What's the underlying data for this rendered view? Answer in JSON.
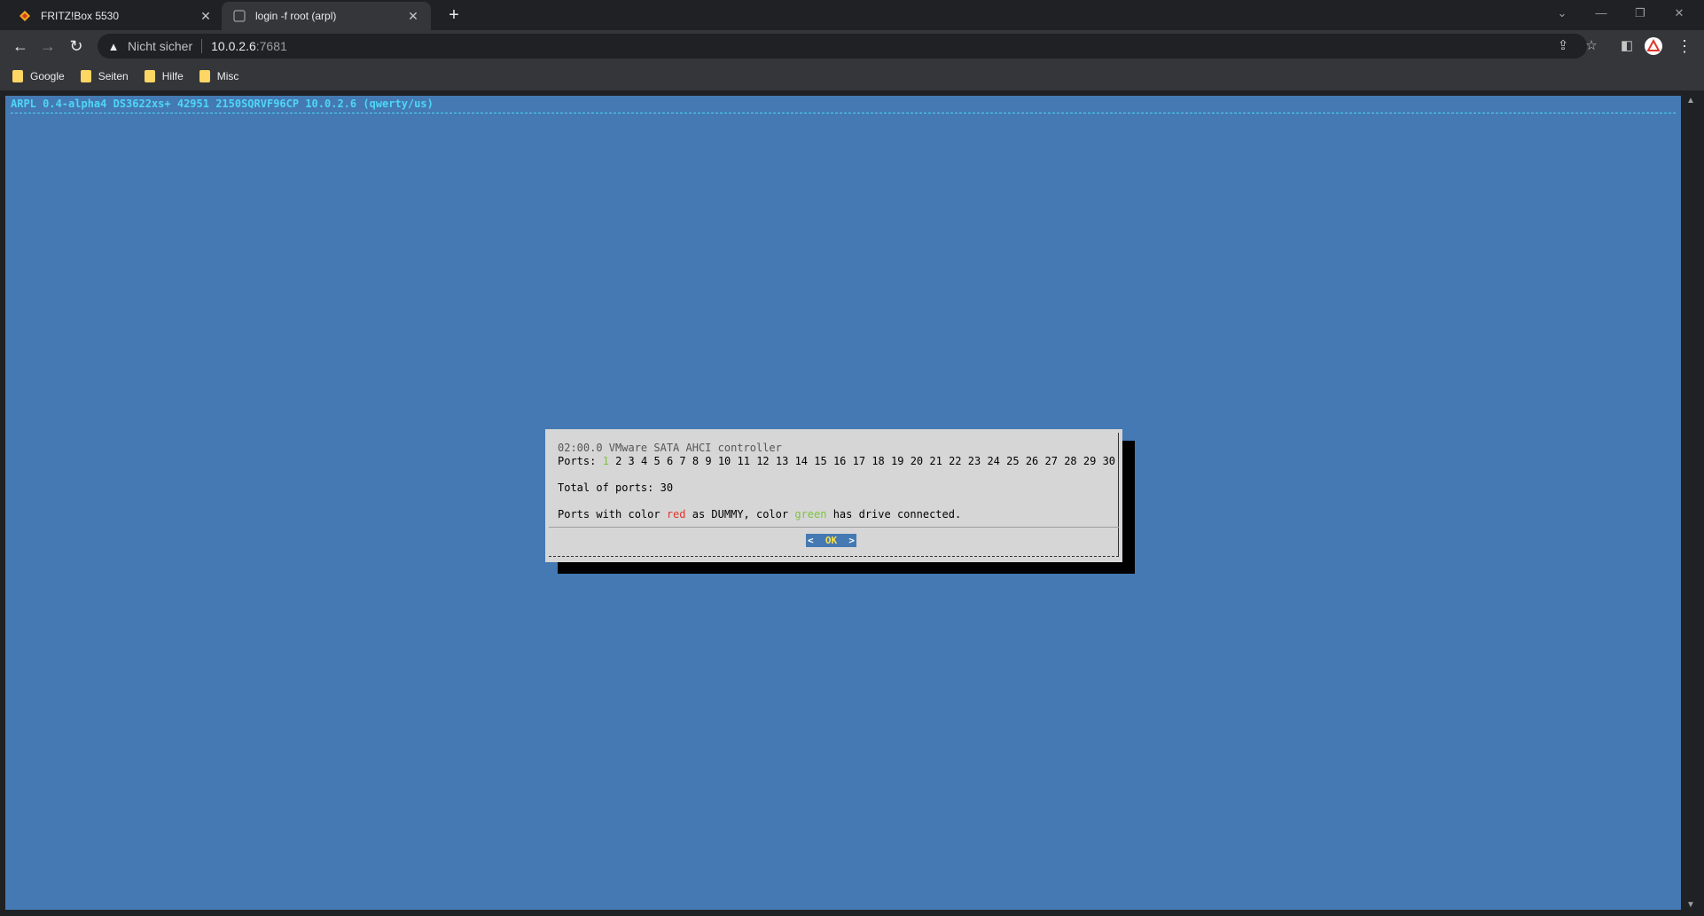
{
  "tabs": [
    {
      "title": "FRITZ!Box 5530",
      "icon": "fritzbox-icon",
      "active": false
    },
    {
      "title": "login -f root (arpl)",
      "icon": "terminal-tab-icon",
      "active": true
    }
  ],
  "address_bar": {
    "security_label": "Nicht sicher",
    "host": "10.0.2.6",
    "port": ":7681"
  },
  "bookmarks": [
    {
      "label": "Google",
      "icon": "folder-icon"
    },
    {
      "label": "Seiten",
      "icon": "folder-icon"
    },
    {
      "label": "Hilfe",
      "icon": "folder-icon"
    },
    {
      "label": "Misc",
      "icon": "folder-icon"
    }
  ],
  "terminal": {
    "status_line": "ARPL 0.4-alpha4 DS3622xs+ 42951 2150SQRVF96CP 10.0.2.6 (qwerty/us)",
    "background": "#4479b3",
    "status_color": "#4fd6f6"
  },
  "dialog": {
    "controller": "02:00.0 VMware SATA AHCI controller",
    "ports_label": "Ports:",
    "ports": [
      "1",
      "2",
      "3",
      "4",
      "5",
      "6",
      "7",
      "8",
      "9",
      "10",
      "11",
      "12",
      "13",
      "14",
      "15",
      "16",
      "17",
      "18",
      "19",
      "20",
      "21",
      "22",
      "23",
      "24",
      "25",
      "26",
      "27",
      "28",
      "29",
      "30"
    ],
    "connected_ports": [
      "1"
    ],
    "total_line": "Total of ports: 30",
    "legend_prefix": "Ports with color ",
    "legend_red": "red",
    "legend_mid": " as DUMMY, color ",
    "legend_green": "green",
    "legend_suffix": " has drive connected.",
    "ok_left": "<",
    "ok_label": "OK",
    "ok_right": ">"
  }
}
